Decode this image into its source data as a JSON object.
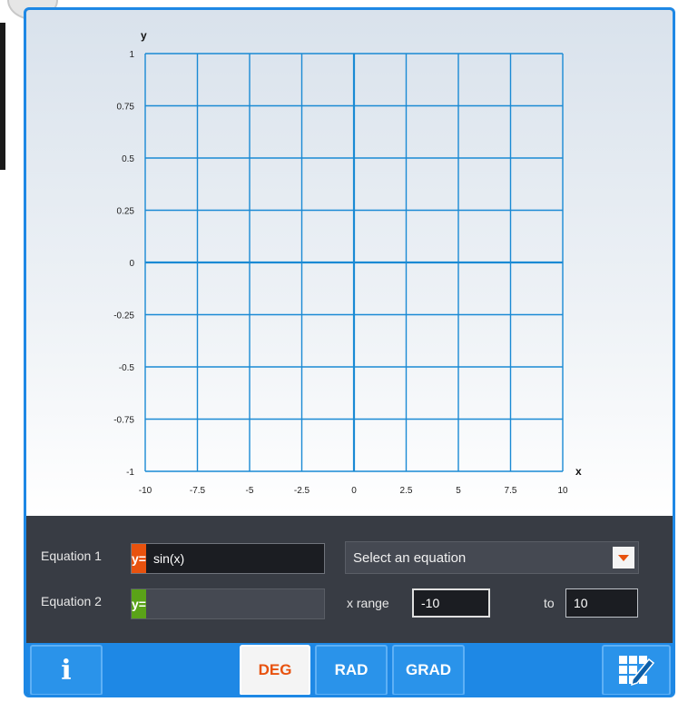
{
  "graph": {
    "x_axis_name": "x",
    "y_axis_name": "y",
    "x_ticks": [
      "-10",
      "-7.5",
      "-5",
      "-2.5",
      "0",
      "2.5",
      "5",
      "7.5",
      "10"
    ],
    "y_ticks": [
      "1",
      "0.75",
      "0.5",
      "0.25",
      "0",
      "-0.25",
      "-0.5",
      "-0.75",
      "-1"
    ],
    "xlim": [
      -10,
      10
    ],
    "ylim": [
      -1,
      1
    ],
    "grid": true,
    "line_color": "#1a8ad4"
  },
  "equations": [
    {
      "label": "Equation 1",
      "tag": "y=",
      "tag_color": "#e8520e",
      "value": "sin(x)"
    },
    {
      "label": "Equation 2",
      "tag": "y=",
      "tag_color": "#5aa318",
      "value": ""
    }
  ],
  "preset_select": {
    "value": "Select an equation"
  },
  "range": {
    "label": "x range",
    "from": "-10",
    "to_label": "to",
    "to": "10"
  },
  "toolbar": {
    "info_label": "i",
    "modes": [
      {
        "label": "DEG",
        "selected": true
      },
      {
        "label": "RAD",
        "selected": false
      },
      {
        "label": "GRAD",
        "selected": false
      }
    ],
    "edit_icon": "grid-pencil-icon"
  },
  "colors": {
    "accent": "#1e88e5",
    "panel": "#383c44",
    "highlight": "#e8520e"
  }
}
